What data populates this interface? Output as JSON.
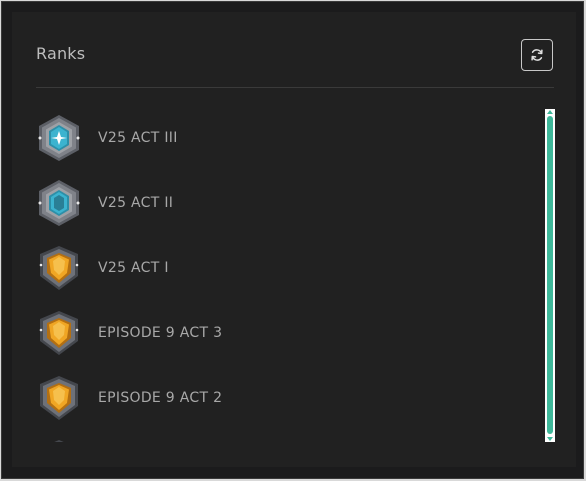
{
  "panel": {
    "title": "Ranks",
    "refresh_icon": "refresh-icon"
  },
  "ranks": [
    {
      "label": "V25 ACT III",
      "badge": "diamond-rank-icon",
      "color": "#3aa9c4"
    },
    {
      "label": "V25 ACT II",
      "badge": "diamond-rank-icon",
      "color": "#3aa9c4"
    },
    {
      "label": "V25 ACT I",
      "badge": "gold-rank-icon",
      "color": "#e39a1d"
    },
    {
      "label": "EPISODE 9 ACT 3",
      "badge": "gold-rank-icon",
      "color": "#e39a1d"
    },
    {
      "label": "EPISODE 9 ACT 2",
      "badge": "gold-rank-icon",
      "color": "#e39a1d"
    }
  ],
  "colors": {
    "accent": "#3eb89a",
    "background": "#212121",
    "text": "#a8a8a8"
  }
}
